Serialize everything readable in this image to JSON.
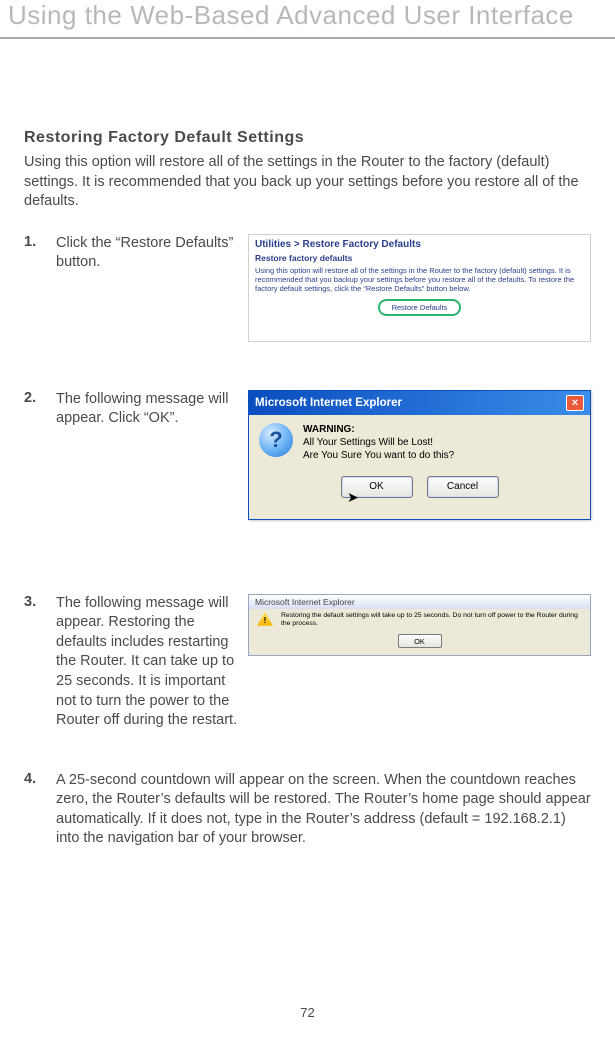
{
  "page": {
    "header": "Using the Web-Based Advanced User Interface",
    "page_number": "72"
  },
  "section": {
    "title": "Restoring Factory Default Settings",
    "description": "Using this option will restore all of the settings in the Router to the factory (default) settings. It is recommended that you back up your settings before you restore all of the defaults."
  },
  "steps": [
    {
      "num": "1.",
      "text": "Click the “Restore Defaults” button."
    },
    {
      "num": "2.",
      "text": "The following message will appear. Click “OK”."
    },
    {
      "num": "3.",
      "text": "The following message will appear. Restoring the defaults includes restarting the Router. It can take up to 25 seconds. It is important not to turn the power to the Router off during the restart."
    },
    {
      "num": "4.",
      "text": "A 25-second countdown will appear on the screen. When the countdown reaches zero, the Router’s defaults will be restored. The Router’s home page should appear automatically. If it does not, type in the Router’s address (default = 192.168.2.1) into the navigation bar of your browser."
    }
  ],
  "screenshot1": {
    "title": "Utilities > Restore Factory Defaults",
    "subtitle": "Restore factory defaults",
    "body": "Using this option will restore all of the settings in the Router to the factory (default) settings. It is recommended that you backup your settings before you restore all of the defaults. To restore the factory default settings, click the “Restore Defaults” button below.",
    "button": "Restore Defaults"
  },
  "screenshot2": {
    "titlebar": "Microsoft Internet Explorer",
    "warning_label": "WARNING:",
    "line1": "All Your Settings Will be Lost!",
    "line2": "Are You Sure You want to do this?",
    "ok": "OK",
    "cancel": "Cancel"
  },
  "screenshot3": {
    "titlebar": "Microsoft Internet Explorer",
    "msg": "Restoring the default settings will take up to 25 seconds. Do not turn off power to the Router during the process.",
    "ok": "OK"
  }
}
